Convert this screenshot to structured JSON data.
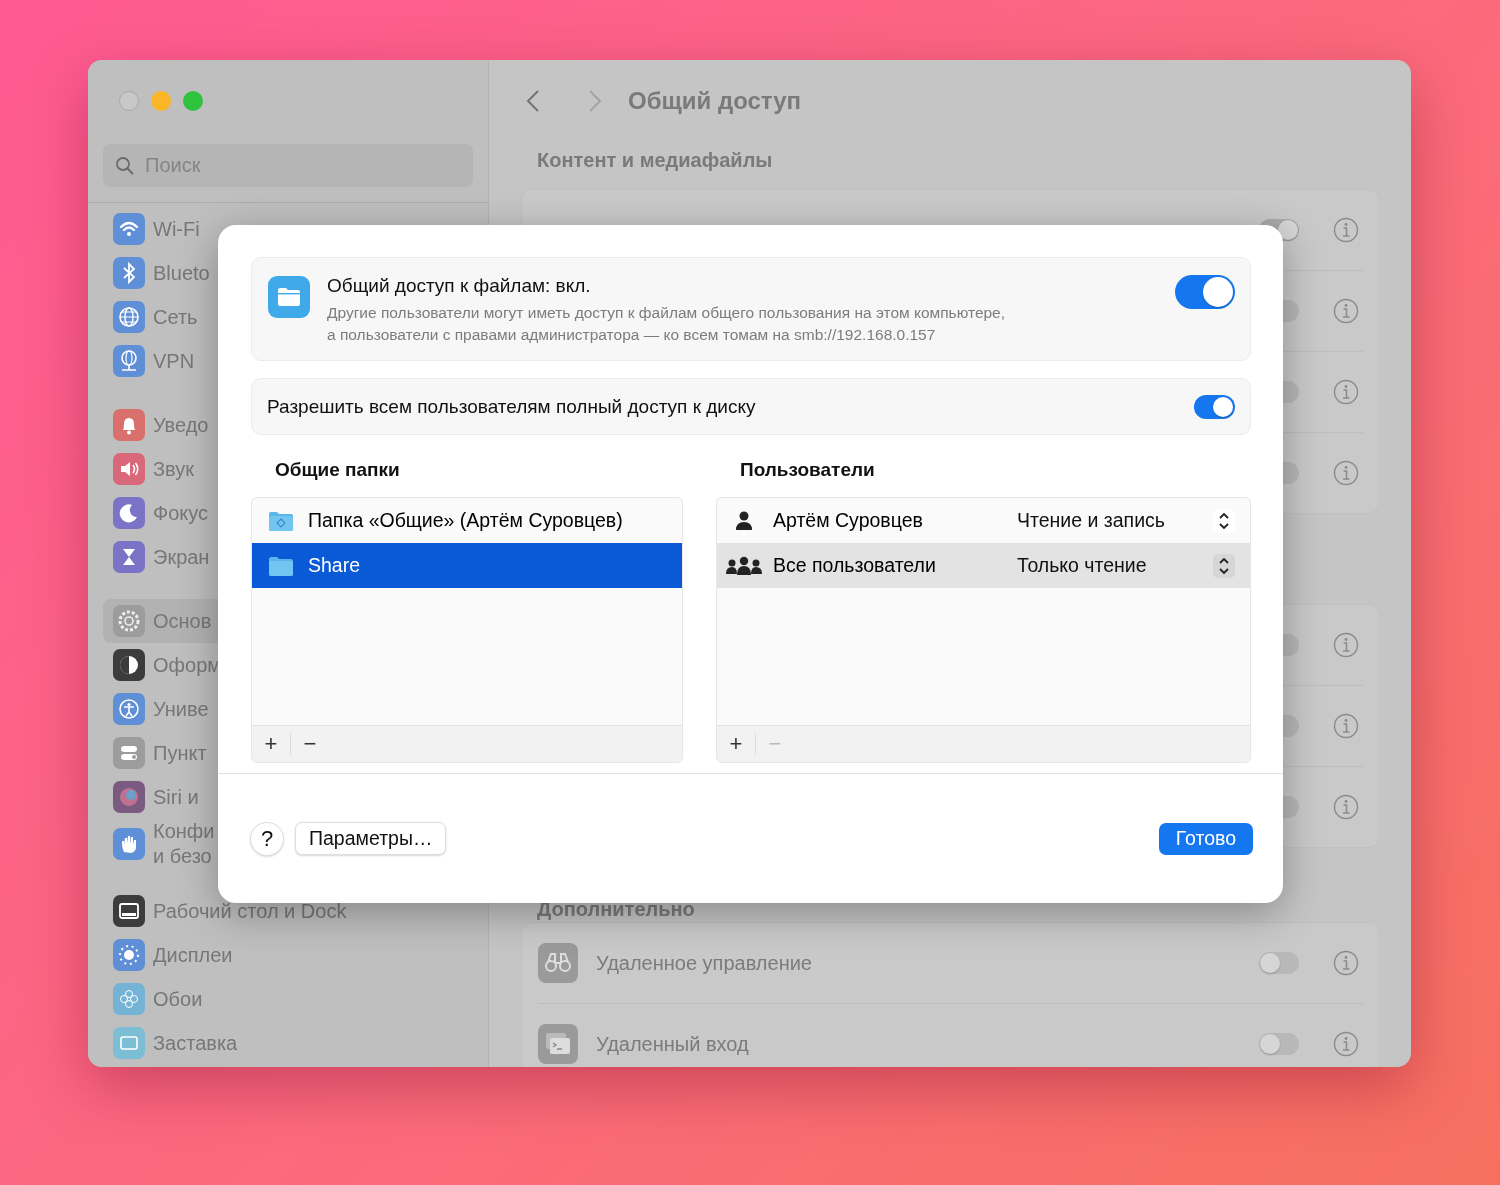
{
  "sidebar": {
    "search": {
      "placeholder": "Поиск"
    },
    "groups": [
      [
        {
          "label": "Wi-Fi",
          "selected": false
        },
        {
          "label": "Blueto",
          "selected": false
        },
        {
          "label": "Сеть",
          "selected": false
        },
        {
          "label": "VPN",
          "selected": false
        }
      ],
      [
        {
          "label": "Уведо",
          "selected": false
        },
        {
          "label": "Звук",
          "selected": false
        },
        {
          "label": "Фокус",
          "selected": false
        },
        {
          "label": "Экран",
          "selected": false
        }
      ],
      [
        {
          "label": "Основ",
          "selected": true
        },
        {
          "label": "Оформ",
          "selected": false
        },
        {
          "label": "Униве",
          "selected": false
        },
        {
          "label": "Пункт",
          "selected": false
        },
        {
          "label": "Siri и",
          "selected": false
        },
        {
          "label": "Конфи\nи безо",
          "selected": false
        }
      ],
      [
        {
          "label": "Рабочий стол и Dock",
          "selected": false
        },
        {
          "label": "Дисплеи",
          "selected": false
        },
        {
          "label": "Обои",
          "selected": false
        },
        {
          "label": "Заставка",
          "selected": false
        }
      ]
    ]
  },
  "nav": [
    {
      "kind": "back",
      "disabled": false
    },
    {
      "kind": "forward",
      "disabled": true
    }
  ],
  "title": "Общий доступ",
  "sections": [
    {
      "heading": "Контент и медиафайлы",
      "groups": [
        [
          {
            "on": true
          },
          {
            "on": false
          },
          {
            "on": false
          },
          {
            "on": false
          }
        ],
        [
          {
            "on": false
          },
          {
            "on": false
          },
          {
            "on": false
          }
        ]
      ]
    },
    {
      "heading": "Дополнительно",
      "groups": [
        [
          {
            "kind": "remote-management",
            "label": "Удаленное управление",
            "on": false
          },
          {
            "kind": "remote-login",
            "label": "Удаленный вход",
            "on": false
          }
        ]
      ]
    }
  ],
  "dialog": {
    "service": {
      "title": "Общий доступ к файлам: вкл.",
      "description": [
        "Другие пользователи могут иметь доступ к файлам общего пользования на этом компьютере,",
        "а пользователи с правами администратора — ко всем томам на smb://192.168.0.157"
      ],
      "on": true
    },
    "full_disk": {
      "label": "Разрешить всем пользователям полный доступ к диску",
      "on": true
    },
    "folders": {
      "heading": "Общие папки",
      "items": [
        {
          "kind": "public",
          "name": "Папка «Общие» (Артём Суровцев)",
          "selected": false
        },
        {
          "kind": "plain",
          "name": "Share",
          "selected": true
        }
      ],
      "add": "+",
      "remove": "−",
      "remove_disabled": false
    },
    "users": {
      "heading": "Пользователи",
      "items": [
        {
          "kind": "user",
          "name": "Артём Суровцев",
          "permission": "Чтение и запись",
          "selected": false
        },
        {
          "kind": "group",
          "name": "Все пользователи",
          "permission": "Только чтение",
          "selected": true
        }
      ],
      "add": "+",
      "remove": "−",
      "remove_disabled": true
    },
    "help": "?",
    "options": "Параметры…",
    "done": "Готово"
  }
}
